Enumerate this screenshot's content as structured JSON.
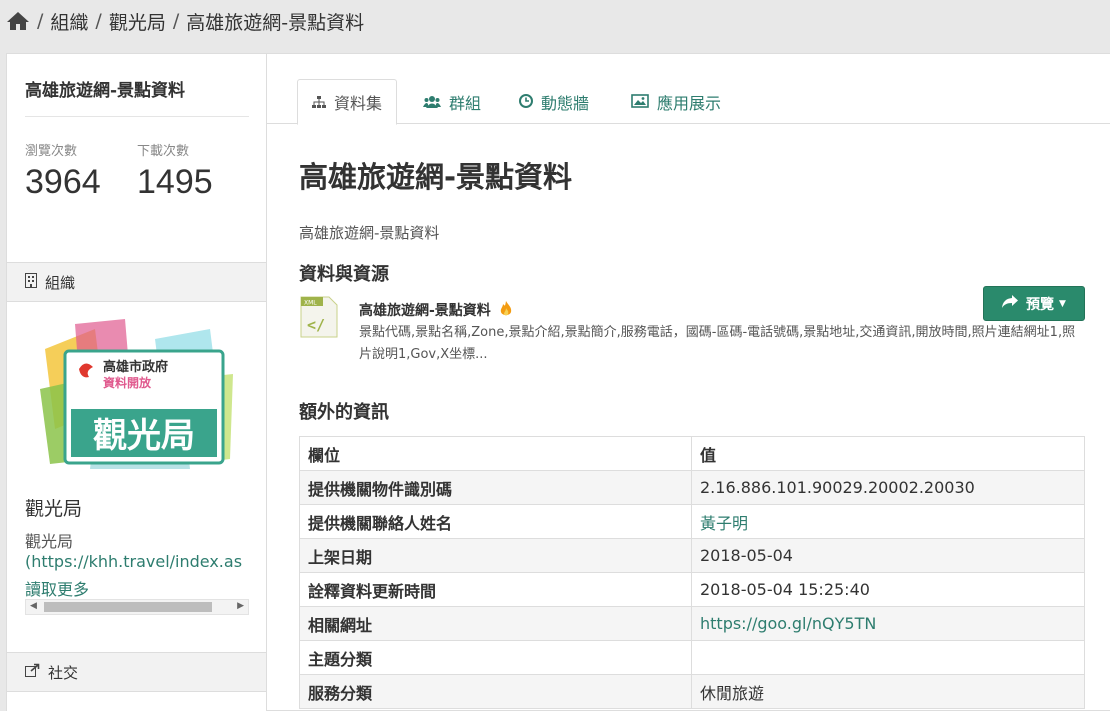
{
  "breadcrumb": {
    "items": [
      "組織",
      "觀光局"
    ],
    "current": "高雄旅遊網-景點資料",
    "separator": "/"
  },
  "sidebar": {
    "title": "高雄旅遊網-景點資料",
    "views_label": "瀏覽次數",
    "views_value": "3964",
    "downloads_label": "下載次數",
    "downloads_value": "1495",
    "org_section_label": "組織",
    "logo": {
      "line1": "高雄市政府",
      "line2": "資料開放",
      "main": "觀光局"
    },
    "org_name": "觀光局",
    "org_desc": "觀光局",
    "org_link": "(https://khh.travel/index.as",
    "read_more": "讀取更多",
    "social_label": "社交"
  },
  "tabs": [
    {
      "label": "資料集",
      "icon": "sitemap-icon",
      "active": true
    },
    {
      "label": "群組",
      "icon": "users-icon",
      "active": false
    },
    {
      "label": "動態牆",
      "icon": "clock-icon",
      "active": false
    },
    {
      "label": "應用展示",
      "icon": "image-icon",
      "active": false
    }
  ],
  "main": {
    "title": "高雄旅遊網-景點資料",
    "subtitle": "高雄旅遊網-景點資料",
    "resources_heading": "資料與資源",
    "resource": {
      "name": "高雄旅遊網-景點資料",
      "format": "XML",
      "description": "景點代碼,景點名稱,Zone,景點介紹,景點簡介,服務電話，國碼-區碼-電話號碼,景點地址,交通資訊,開放時間,照片連結網址1,照片說明1,Gov,X坐標..."
    },
    "preview_button": "預覽",
    "extra_heading": "額外的資訊",
    "table": {
      "headers": [
        "欄位",
        "值"
      ],
      "rows": [
        {
          "key": "提供機關物件識別碼",
          "value": "2.16.886.101.90029.20002.20030"
        },
        {
          "key": "提供機關聯絡人姓名",
          "value": "黃子明"
        },
        {
          "key": "上架日期",
          "value": "2018-05-04"
        },
        {
          "key": "詮釋資料更新時間",
          "value": "2018-05-04 15:25:40"
        },
        {
          "key": "相關網址",
          "value": "https://goo.gl/nQY5TN"
        },
        {
          "key": "主題分類",
          "value": ""
        },
        {
          "key": "服務分類",
          "value": "休閒旅遊"
        }
      ]
    }
  },
  "colors": {
    "accent": "#2e7d6f",
    "button": "#2a8a6c",
    "background": "#e8e8e8"
  }
}
